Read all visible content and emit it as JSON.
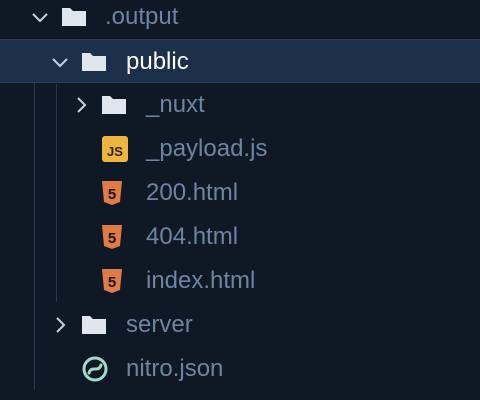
{
  "theme": {
    "background": "#0f1825",
    "selected_row": "#1c3149",
    "text_muted": "#6f84a0",
    "text_selected": "#ffffff",
    "folder_icon": "#dfe6ee",
    "html_icon": "#e07b48",
    "js_icon": "#f0b53f",
    "json_icon": "#a8d7cb"
  },
  "tree": {
    "items": [
      {
        "name": ".output",
        "kind": "folder",
        "expanded": true,
        "icon": "folder-icon"
      },
      {
        "name": "public",
        "kind": "folder",
        "expanded": true,
        "selected": true,
        "icon": "folder-icon"
      },
      {
        "name": "_nuxt",
        "kind": "folder",
        "expanded": false,
        "icon": "folder-icon"
      },
      {
        "name": "_payload.js",
        "kind": "file",
        "icon": "js-file-icon",
        "badge": "JS"
      },
      {
        "name": "200.html",
        "kind": "file",
        "icon": "html-file-icon",
        "badge": "5"
      },
      {
        "name": "404.html",
        "kind": "file",
        "icon": "html-file-icon",
        "badge": "5"
      },
      {
        "name": "index.html",
        "kind": "file",
        "icon": "html-file-icon",
        "badge": "5"
      },
      {
        "name": "server",
        "kind": "folder",
        "expanded": false,
        "icon": "folder-icon"
      },
      {
        "name": "nitro.json",
        "kind": "file",
        "icon": "nitro-json-icon"
      }
    ]
  }
}
